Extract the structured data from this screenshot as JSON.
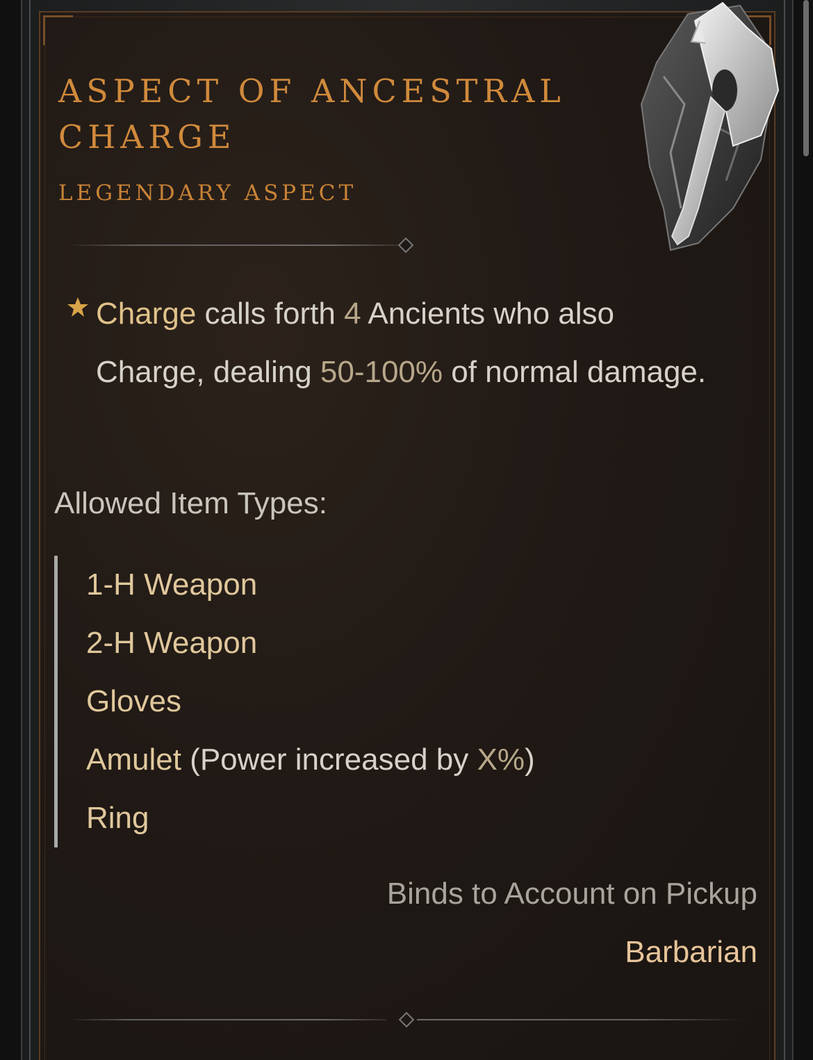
{
  "tooltip": {
    "title": "Aspect of Ancestral Charge",
    "subtitle": "Legendary Aspect",
    "description": {
      "highlight_skill": "Charge",
      "text1": " calls forth ",
      "count": "4",
      "text2": " Ancients who also Charge, dealing ",
      "damage_range": "50-100%",
      "text3": " of normal damage."
    },
    "allowed_label": "Allowed Item Types:",
    "allowed_types": [
      {
        "name": "1-H Weapon"
      },
      {
        "name": "2-H Weapon"
      },
      {
        "name": "Gloves"
      },
      {
        "name": "Amulet",
        "note_prefix": " (Power increased by ",
        "note_value": "X%",
        "note_suffix": ")"
      },
      {
        "name": "Ring"
      }
    ],
    "binds": "Binds to Account on Pickup",
    "class_requirement": "Barbarian"
  },
  "colors": {
    "title": "#d08a3c",
    "highlight": "#e0c28a",
    "text": "#d6d2ca",
    "muted": "#a8a49e"
  },
  "icons": {
    "aspect_image": "axe-icon",
    "bullet": "star-icon"
  }
}
